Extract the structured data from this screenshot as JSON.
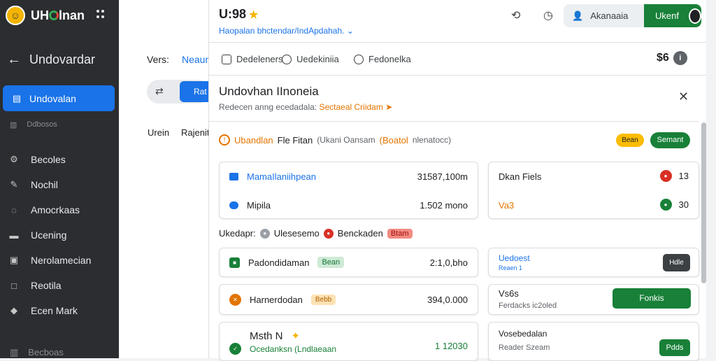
{
  "sidebar": {
    "brand": "UH",
    "brand_rest": "lnan",
    "back_label": "Undovardar",
    "active_item": "Undovalan",
    "sub_items": [
      "Ddbosos"
    ],
    "items": [
      {
        "label": "Becoles",
        "icon": "wrench-icon",
        "glyph": "⚙"
      },
      {
        "label": "Nochil",
        "icon": "pen-icon",
        "glyph": "✎"
      },
      {
        "label": "Amocrkaas",
        "icon": "chat-icon",
        "glyph": "◌"
      },
      {
        "label": "Ucening",
        "icon": "folder-icon",
        "glyph": "▬"
      },
      {
        "label": "Nerolamecian",
        "icon": "image-icon",
        "glyph": "▣"
      },
      {
        "label": "Reotila",
        "icon": "doc-icon",
        "glyph": "□"
      },
      {
        "label": "Ecen Mark",
        "icon": "tag-icon",
        "glyph": "◆"
      }
    ],
    "footer": "Becboas"
  },
  "background": {
    "label1": "Vers:",
    "link": "Neaun",
    "btn": "Rat",
    "cell1": "Urein",
    "cell2": "Rajenit"
  },
  "panel": {
    "title": "U:98",
    "breadcrumb": "Haopalan bhctendar/IndApdahah.",
    "account": "Akanaaia",
    "user": "Ukenf",
    "tabs": [
      "Dedeleners",
      "Uedekiniia",
      "Fedonelka"
    ],
    "count": "$6",
    "dialog_title": "Undovhan IInoneia",
    "dialog_sub": "Redecen anng ecedadala:",
    "dialog_warn": "Sectaeal Criidam",
    "section": "Ubandlan",
    "section_b": "Fle Fitan",
    "section_c": "(Ukani Oansam",
    "section_d": "(Boatol",
    "section_e": "nlenatocc)",
    "pill_yellow": "Bean",
    "pill_green": "Semant",
    "rows_a": [
      {
        "label": "MamaIlaniihpean",
        "value": "31587,100m"
      },
      {
        "label": "Mipila",
        "value": "1.502 mono"
      }
    ],
    "rows_b": [
      {
        "label": "Dkan Fiels",
        "value": "13"
      },
      {
        "label": "Va3",
        "value": "30"
      }
    ],
    "legend": [
      "Ukedapr:",
      "Ulesesemo",
      "Benckaden",
      "Btam"
    ],
    "cards": [
      {
        "label": "Padondidaman",
        "tag": "Bean",
        "value": "2:1,0,bho"
      },
      {
        "label": "Harnerdodan",
        "tag": "Bebb",
        "value": "394,0.000"
      },
      {
        "label": "Msth N",
        "sub": "Ocedanksn (Lndlaeaan",
        "value": "1 12030"
      }
    ],
    "right_cards": [
      {
        "title": "Uedoest",
        "sub": "Reaen 1",
        "btn": "Hdle"
      },
      {
        "title": "Vs6s",
        "sub": "Ferdacks ic2oled",
        "btn": "Fonkis"
      },
      {
        "title": "Vosebedalan",
        "sub": "Reader Szeam",
        "btn": "Pdds"
      }
    ]
  }
}
